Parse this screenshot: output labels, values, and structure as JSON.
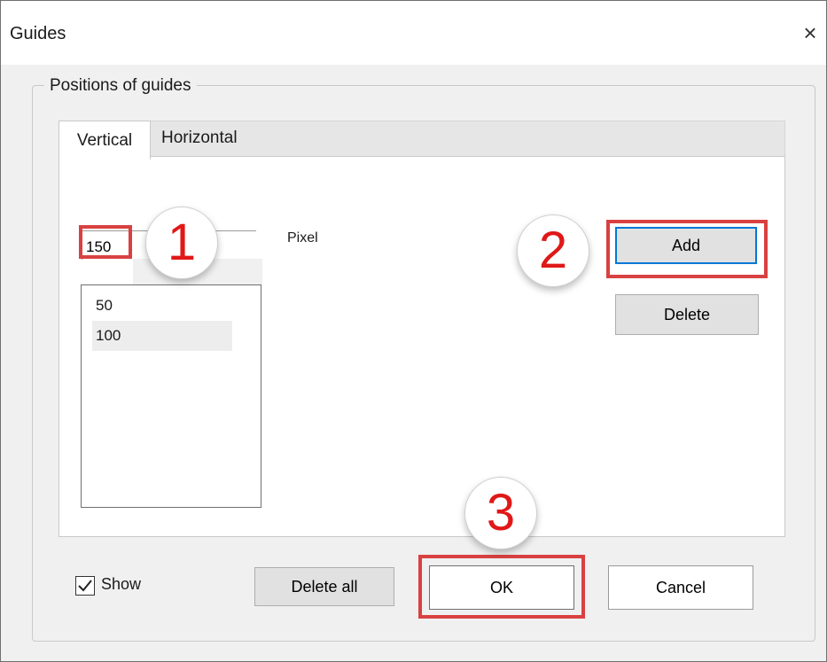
{
  "window": {
    "title": "Guides",
    "close_symbol": "×"
  },
  "group": {
    "label": "Positions of guides"
  },
  "tabs": [
    {
      "label": "Vertical",
      "selected": true
    },
    {
      "label": "Horizontal",
      "selected": false
    }
  ],
  "position_input": {
    "value": "150",
    "unit_label": "Pixel"
  },
  "guide_list": {
    "items": [
      "50",
      "100"
    ]
  },
  "buttons": {
    "add": "Add",
    "delete": "Delete",
    "delete_all": "Delete all",
    "ok": "OK",
    "cancel": "Cancel"
  },
  "show_checkbox": {
    "label": "Show",
    "checked": true,
    "check_glyph": "✓"
  },
  "callouts": [
    "1",
    "2",
    "3"
  ],
  "colors": {
    "highlight": "#d94141",
    "callout_text": "#e01818",
    "focus_border": "#0078d7"
  }
}
